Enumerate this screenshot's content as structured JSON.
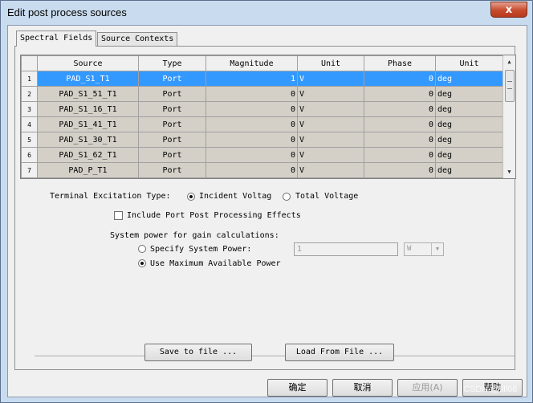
{
  "window": {
    "title": "Edit post process sources",
    "close_label": "x"
  },
  "tabs": [
    {
      "label": "Spectral Fields",
      "active": true
    },
    {
      "label": "Source Contexts",
      "active": false
    }
  ],
  "grid": {
    "headers": [
      "Source",
      "Type",
      "Magnitude",
      "Unit",
      "Phase",
      "Unit"
    ],
    "rows": [
      {
        "num": "1",
        "source": "PAD_S1_T1",
        "type": "Port",
        "magnitude": "1",
        "unit": "V",
        "phase": "0",
        "phase_unit": "deg",
        "selected": true
      },
      {
        "num": "2",
        "source": "PAD_S1_51_T1",
        "type": "Port",
        "magnitude": "0",
        "unit": "V",
        "phase": "0",
        "phase_unit": "deg",
        "selected": false
      },
      {
        "num": "3",
        "source": "PAD_S1_16_T1",
        "type": "Port",
        "magnitude": "0",
        "unit": "V",
        "phase": "0",
        "phase_unit": "deg",
        "selected": false
      },
      {
        "num": "4",
        "source": "PAD_S1_41_T1",
        "type": "Port",
        "magnitude": "0",
        "unit": "V",
        "phase": "0",
        "phase_unit": "deg",
        "selected": false
      },
      {
        "num": "5",
        "source": "PAD_S1_30_T1",
        "type": "Port",
        "magnitude": "0",
        "unit": "V",
        "phase": "0",
        "phase_unit": "deg",
        "selected": false
      },
      {
        "num": "6",
        "source": "PAD_S1_62_T1",
        "type": "Port",
        "magnitude": "0",
        "unit": "V",
        "phase": "0",
        "phase_unit": "deg",
        "selected": false
      },
      {
        "num": "7",
        "source": "PAD_P_T1",
        "type": "Port",
        "magnitude": "0",
        "unit": "V",
        "phase": "0",
        "phase_unit": "deg",
        "selected": false
      }
    ]
  },
  "excitation": {
    "label": "Terminal Excitation Type:",
    "incident_label": "Incident Voltag",
    "total_label": "Total Voltage",
    "selected": "incident"
  },
  "include_post_processing": {
    "label": "Include Port Post Processing Effects",
    "checked": false
  },
  "system_power": {
    "label": "System power for gain calculations:",
    "specify_label": "Specify System Power:",
    "max_label": "Use Maximum Available Power",
    "selected": "max",
    "power_value": "1",
    "power_unit": "W"
  },
  "buttons": {
    "save": "Save to file ...",
    "load": "Load From File ...",
    "ok": "确定",
    "cancel": "取消",
    "apply": "应用(A)",
    "help": "帮助"
  },
  "watermark": "CSDN @llll66"
}
